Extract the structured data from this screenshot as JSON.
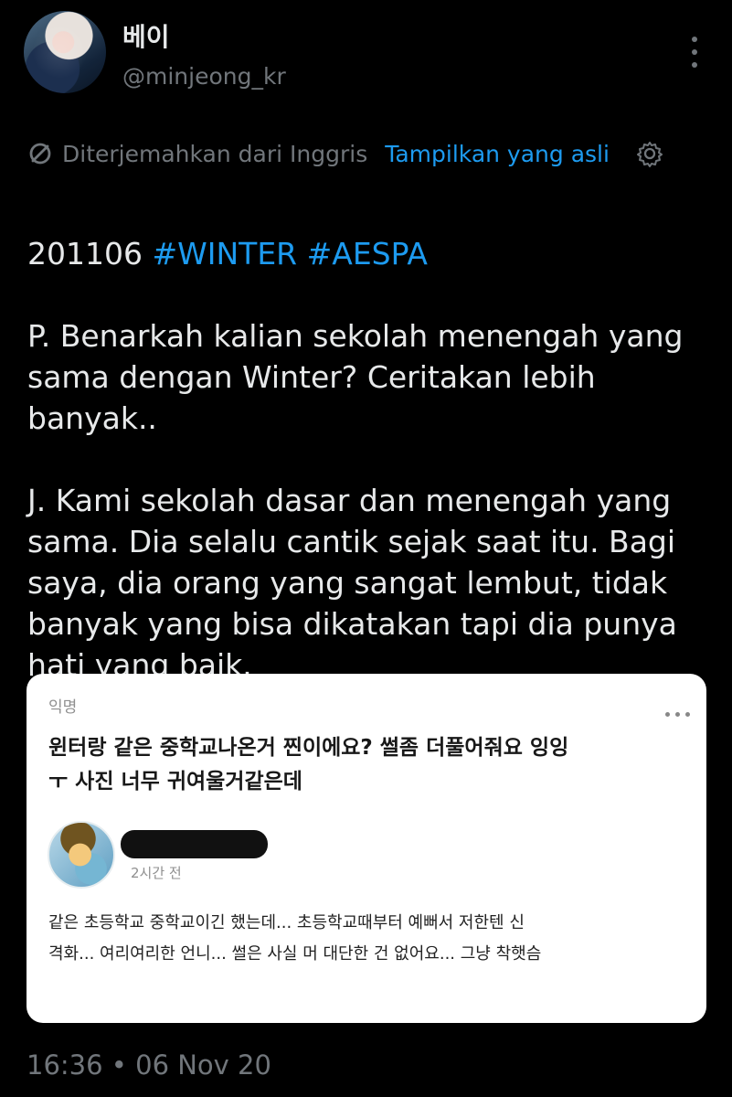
{
  "profile": {
    "name": "베이",
    "handle": "@minjeong_kr"
  },
  "translation_bar": {
    "text": "Diterjemahkan dari Inggris",
    "action": "Tampilkan yang asli"
  },
  "tweet": {
    "date_prefix": "201106 ",
    "hashtags": [
      "#WINTER",
      "#AESPA"
    ],
    "question": "P. Benarkah kalian sekolah menengah yang\nsama dengan Winter? Ceritakan lebih\nbanyak..",
    "answer": "J. Kami sekolah dasar dan menengah yang\nsama. Dia selalu cantik sejak saat itu. Bagi\nsaya, dia orang yang sangat lembut, tidak\nbanyak yang bisa dikatakan tapi dia punya\nhati yang baik."
  },
  "media_card": {
    "label": "익명",
    "title_line1": "윈터랑 같은 중학교나온거 찐이에요? 썰좀 더풀어줘요 잉잉",
    "title_line2": "ㅜ 사진 너무 귀여울거같은데",
    "time": "2시간 전",
    "comment_line1": "같은 초등학교 중학교이긴 했는데... 초등학교때부터 예뻐서 저한텐 신",
    "comment_line2": "격화... 여리여리한 언니... 썰은 사실 머 대단한 건 없어요... 그냥 착햇슴"
  },
  "timestamp": "16:36 • 06 Nov 20",
  "colors": {
    "background": "#000000",
    "text": "#e7e9ea",
    "muted": "#71767b",
    "accent": "#1d9bf0",
    "card": "#ffffff"
  },
  "icons": {
    "translation": "translate-slash-icon",
    "settings": "gear-icon",
    "more": "more-vertical-icon"
  }
}
